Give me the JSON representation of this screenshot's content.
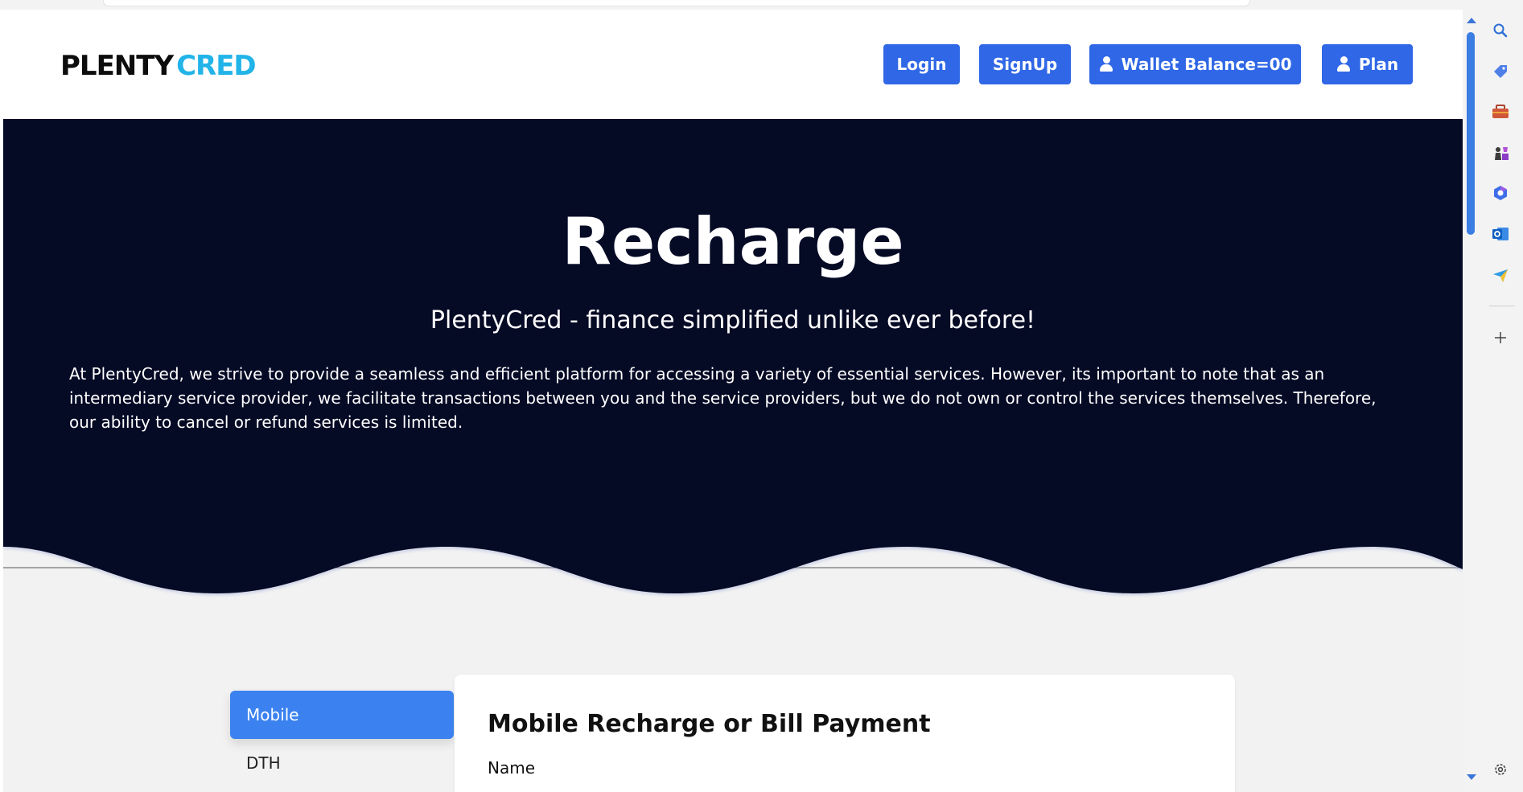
{
  "brand": {
    "logo_part1": "PLENTY",
    "logo_part2": "CRED"
  },
  "nav": {
    "login": "Login",
    "signup": "SignUp",
    "wallet": "Wallet Balance=00",
    "plan": "Plan"
  },
  "hero": {
    "title": "Recharge",
    "subtitle": "PlentyCred - finance simplified unlike ever before!",
    "description": "At PlentyCred, we strive to provide a seamless and efficient platform for accessing a variety of essential services. However, its important to note that as an intermediary service provider, we facilitate transactions between you and the service providers, but we do not own or control the services themselves. Therefore, our ability to cancel or refund services is limited."
  },
  "services": {
    "tabs": [
      {
        "label": "Mobile",
        "active": true
      },
      {
        "label": "DTH",
        "active": false
      }
    ]
  },
  "form": {
    "title": "Mobile Recharge or Bill Payment",
    "name_label": "Name"
  },
  "colors": {
    "primary_button": "#2f67e6",
    "hero_background": "#050a25",
    "active_tab": "#3b82f0",
    "logo_accent": "#22b4e8"
  },
  "edge_sidebar": {
    "icons": [
      "search-icon",
      "tag-icon",
      "briefcase-icon",
      "chess-icon",
      "copilot-icon",
      "outlook-icon",
      "send-icon",
      "add-icon",
      "settings-icon"
    ]
  }
}
